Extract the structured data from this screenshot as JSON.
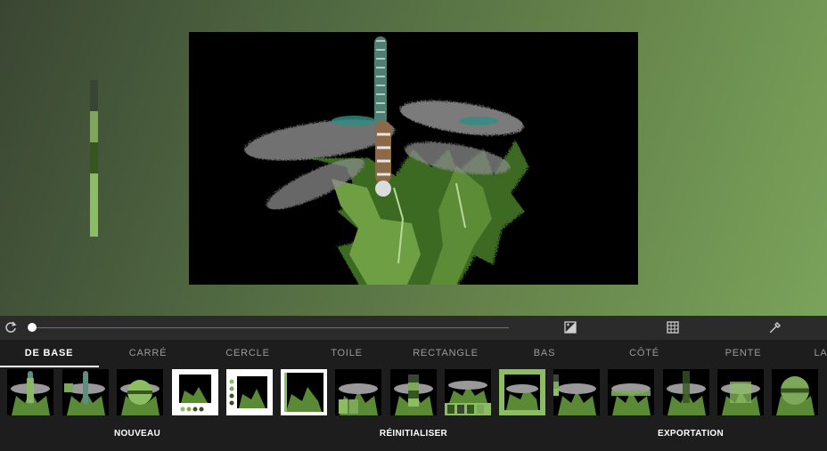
{
  "palette": [
    "#3a4434",
    "#7da85a",
    "#35561f",
    "#8cbd63"
  ],
  "toolbar": {
    "icons": [
      "refresh-icon",
      "exposure-icon",
      "grid-icon",
      "eyedropper-icon"
    ],
    "slider_value": 0
  },
  "tabs": [
    {
      "label": "DE BASE",
      "active": true
    },
    {
      "label": "CARRÉ",
      "active": false
    },
    {
      "label": "CERCLE",
      "active": false
    },
    {
      "label": "TOILE",
      "active": false
    },
    {
      "label": "RECTANGLE",
      "active": false
    },
    {
      "label": "BAS",
      "active": false
    },
    {
      "label": "CÔTÉ",
      "active": false
    },
    {
      "label": "PENTE",
      "active": false
    },
    {
      "label": "LA",
      "active": false
    }
  ],
  "actions": {
    "new_label": "NOUVEAU",
    "reset_label": "RÉINITIALISER",
    "export_label": "EXPORTATION"
  },
  "colors": {
    "accent_green": "#8cbd63",
    "frame_white": "#ffffff"
  }
}
